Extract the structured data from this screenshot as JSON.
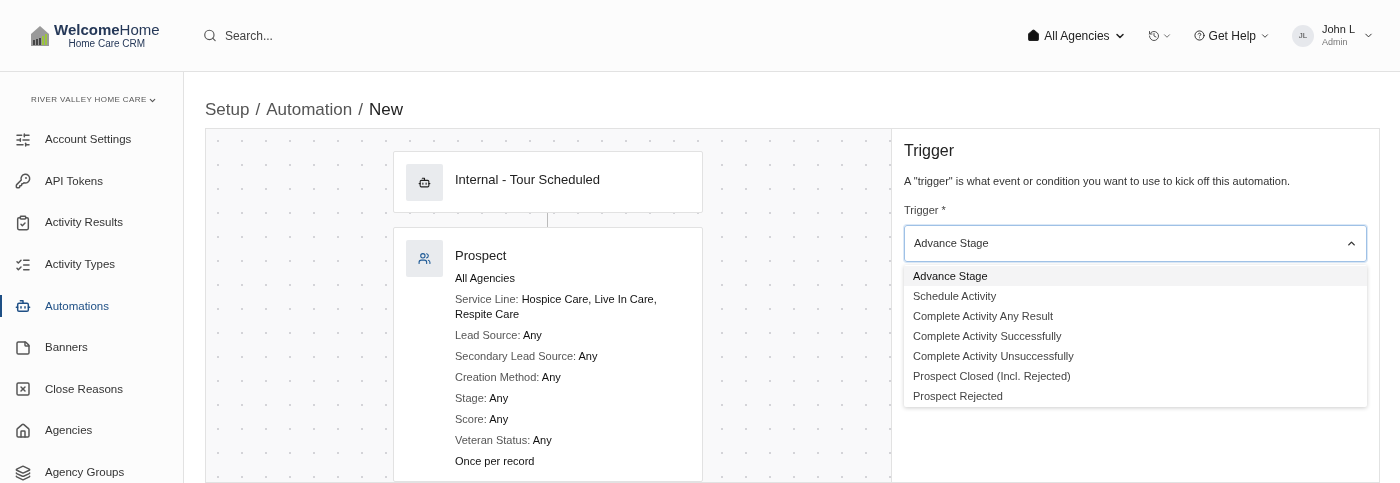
{
  "header": {
    "logo": {
      "name": "**Welcome**Home",
      "subtitle": "Home Care CRM"
    },
    "search": {
      "placeholder": "Search..."
    },
    "agency_menu": "All Agencies",
    "help_menu": "Get Help",
    "user": {
      "initials": "JL",
      "name": "John L",
      "role": "Admin"
    }
  },
  "sidebar": {
    "organization": "RIVER VALLEY HOME CARE",
    "items": [
      {
        "label": "Account Settings",
        "selected": false
      },
      {
        "label": "API Tokens",
        "selected": false
      },
      {
        "label": "Activity Results",
        "selected": false
      },
      {
        "label": "Activity Types",
        "selected": false
      },
      {
        "label": "Automations",
        "selected": true
      },
      {
        "label": "Banners",
        "selected": false
      },
      {
        "label": "Close Reasons",
        "selected": false
      },
      {
        "label": "Agencies",
        "selected": false
      },
      {
        "label": "Agency Groups",
        "selected": false
      }
    ]
  },
  "breadcrumb": {
    "separator": "/",
    "items": [
      "Setup",
      "Automation",
      "New"
    ]
  },
  "nodes": [
    {
      "kind": "trigger",
      "title": "Internal - Tour Scheduled"
    },
    {
      "kind": "audience",
      "title": "Prospect",
      "lines": [
        "**All Agencies**",
        "Service Line: **Hospice Care, Live In Care, Respite Care**",
        "Lead Source: **Any**",
        "Secondary Lead Source: **Any**",
        "Creation Method: **Any**",
        "Stage: **Any**",
        "Score: **Any**",
        "Veteran Status: **Any**",
        "**Once per record**"
      ]
    }
  ],
  "trigger_panel": {
    "title": "Trigger",
    "description": "A \"trigger\" is what event or condition you want to use to kick off this automation.",
    "field_label": "Trigger *",
    "value": "Advance Stage",
    "expanded": true,
    "options": [
      {
        "label": "Advance Stage",
        "selected": true
      },
      {
        "label": "Schedule Activity",
        "selected": false
      },
      {
        "label": "Complete Activity Any Result",
        "selected": false
      },
      {
        "label": "Complete Activity Successfully",
        "selected": false
      },
      {
        "label": "Complete Activity Unsuccessfully",
        "selected": false
      },
      {
        "label": "Prospect Closed (Incl. Rejected)",
        "selected": false
      },
      {
        "label": "Prospect Rejected",
        "selected": false
      }
    ]
  }
}
